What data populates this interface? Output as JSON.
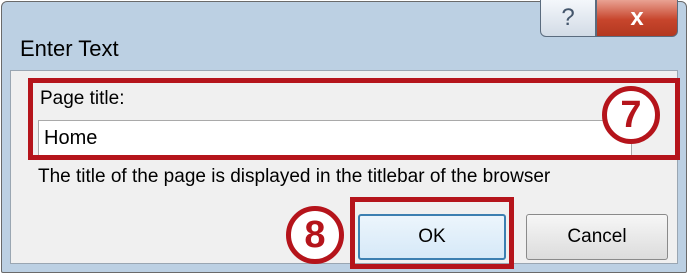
{
  "window": {
    "title": "Enter Text",
    "help_button": "?",
    "close_button": "x"
  },
  "form": {
    "field_label": "Page title:",
    "field_value": "Home",
    "hint": "The title of the page is displayed in the titlebar of the browser"
  },
  "buttons": {
    "ok_label": "OK",
    "cancel_label": "Cancel"
  },
  "annotations": {
    "marker_7": "7",
    "marker_8": "8",
    "highlight_color": "#b5141b"
  }
}
